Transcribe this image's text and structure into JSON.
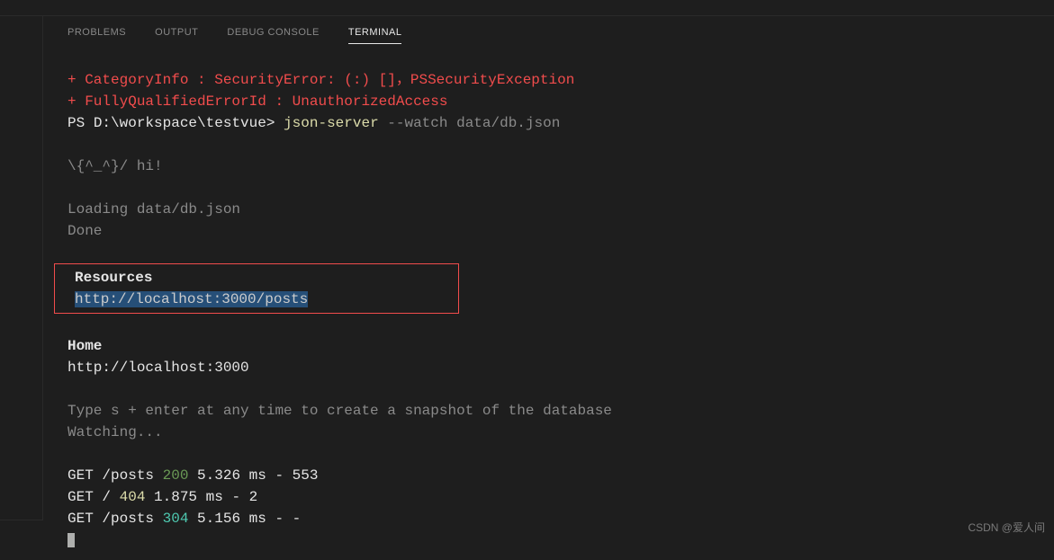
{
  "top_fragment": "",
  "tabs": [
    {
      "label": "PROBLEMS",
      "active": false
    },
    {
      "label": "OUTPUT",
      "active": false
    },
    {
      "label": "DEBUG CONSOLE",
      "active": false
    },
    {
      "label": "TERMINAL",
      "active": true
    }
  ],
  "error": {
    "line1_prefix": "    + CategoryInfo          : ",
    "line1_msg": "SecurityError: (:) []，PSSecurityException",
    "line2_prefix": "    + FullyQualifiedErrorId : ",
    "line2_msg": "UnauthorizedAccess"
  },
  "prompt": {
    "ps": "PS ",
    "path": "D:\\workspace\\testvue>",
    "cmd": " json-server",
    "args": " --watch data/db.json"
  },
  "greeting": "  \\{^_^}/ hi!",
  "loading": {
    "line1": "  Loading data/db.json",
    "line2": "  Done"
  },
  "resources": {
    "heading": "Resources",
    "url": "http://localhost:3000/posts"
  },
  "home": {
    "heading": "  Home",
    "url": "  http://localhost:3000"
  },
  "hint": {
    "line1": "  Type s + enter at any time to create a snapshot of the database",
    "line2": "  Watching..."
  },
  "requests": [
    {
      "method": "GET ",
      "path": "/posts ",
      "status": "200",
      "time": " 5.326 ms - 553",
      "status_class": "green"
    },
    {
      "method": "GET ",
      "path": "/ ",
      "status": "404",
      "time": " 1.875 ms - 2",
      "status_class": "yellow"
    },
    {
      "method": "GET ",
      "path": "/posts ",
      "status": "304",
      "time": " 5.156 ms - -",
      "status_class": "cyan"
    }
  ],
  "watermark": "CSDN @爱人间"
}
